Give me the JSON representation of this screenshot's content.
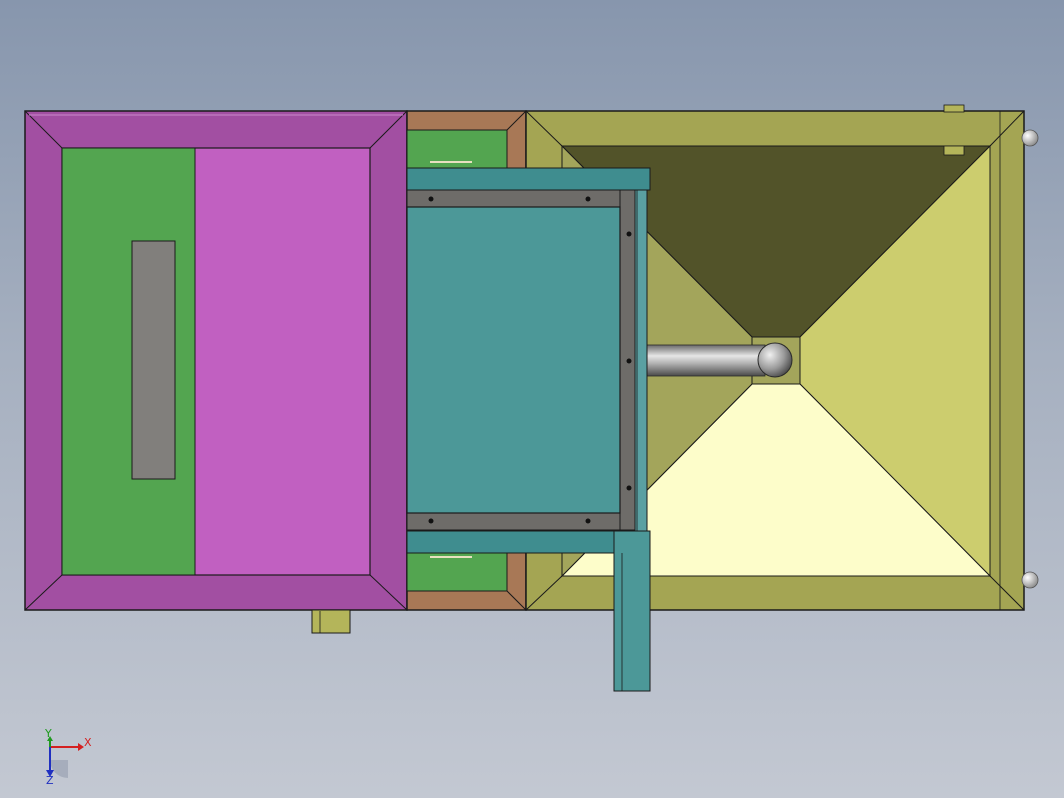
{
  "viewport": {
    "background_top": "#8796ad",
    "background_bottom": "#c3c8d2"
  },
  "colors": {
    "magenta_frame": "#a24fa2",
    "magenta_panel": "#c160c1",
    "green_panel": "#53a550",
    "gray_slot": "#817f7c",
    "brown_frame": "#a87856",
    "teal_body": "#4c9898",
    "teal_frame": "#3f8d8f",
    "gray_rail": "#6e6c69",
    "olive_frame": "#a4a553",
    "hopper_dark": "#525329",
    "hopper_mid": "#a3a55b",
    "hopper_light": "#cccd6e",
    "hopper_pale": "#fdfdca",
    "pipe_gray": "#8c8c8c",
    "axis_x": "#d42020",
    "axis_y": "#1f9a1f",
    "axis_z": "#2030c0"
  },
  "axis_triad": {
    "x_label": "X",
    "y_label": "Y",
    "z_label": "Z"
  }
}
